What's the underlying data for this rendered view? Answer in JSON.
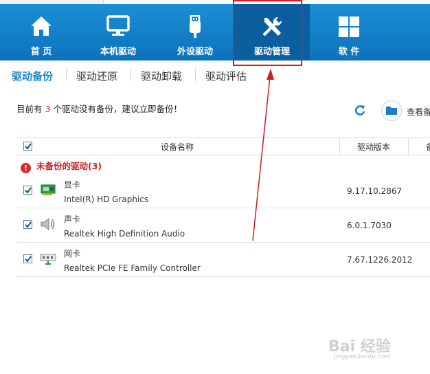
{
  "nav": {
    "items": [
      {
        "label": "首 页",
        "icon": "home-icon"
      },
      {
        "label": "本机驱动",
        "icon": "monitor-icon"
      },
      {
        "label": "外设驱动",
        "icon": "usb-icon"
      },
      {
        "label": "驱动管理",
        "icon": "wrench-screwdriver-icon"
      },
      {
        "label": "软 件",
        "icon": "apps-grid-icon"
      }
    ],
    "active_index": 3
  },
  "tabs": [
    "驱动备份",
    "驱动还原",
    "驱动卸载",
    "驱动评估"
  ],
  "notice": {
    "prefix": "目前有",
    "count": "3",
    "suffix": "个驱动没有备份，建议立即备份！"
  },
  "toolbar": {
    "view_backup_label": "查看备"
  },
  "table": {
    "col_name": "设备名称",
    "col_version": "驱动版本",
    "col_more": "备",
    "group_label": "未备份的驱动(3)",
    "rows": [
      {
        "category": "显卡",
        "name": "Intel(R) HD Graphics",
        "version": "9.17.10.2867",
        "icon": "graphics-card-icon"
      },
      {
        "category": "声卡",
        "name": "Realtek High Definition Audio",
        "version": "6.0.1.7030",
        "icon": "speaker-icon"
      },
      {
        "category": "网卡",
        "name": "Realtek PCIe FE Family Controller",
        "version": "7.67.1226.2012",
        "icon": "network-card-icon"
      }
    ]
  },
  "watermark": {
    "text": "Bai 经验",
    "url": "jingyan.baidu.com"
  },
  "colors": {
    "nav_blue": "#1584cc",
    "active_tab": "#1a86cc",
    "highlight_red": "#d91a1a"
  }
}
